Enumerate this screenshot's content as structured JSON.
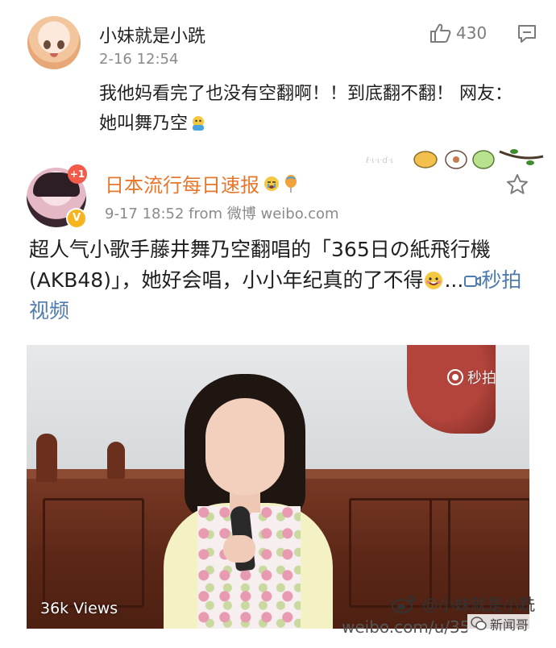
{
  "comment": {
    "username": "小妹就是小跣",
    "time": "2-16 12:54",
    "like_count": "430",
    "text": "我他妈看完了也没有空翻啊！！到底翻不翻！ 网友：她叫舞乃空",
    "icons": [
      "thumbs-up-icon",
      "reply-icon",
      "emoji-icon"
    ]
  },
  "post": {
    "account_name": "日本流行每日速报",
    "avatar_badge": "+1",
    "meta": "9-17 18:52  from 微博 weibo.com",
    "text_main": "超人气小歌手藤井舞乃空翻唱的「365日の紙飛行機 (AKB48)」，她好会唱，小小年纪真的了不得",
    "ellipsis": "...",
    "video_link": "秒拍视频",
    "icons": [
      "star-icon",
      "vip-badge-icon",
      "crying-emoji-icon",
      "balloon-icon",
      "video-link-icon"
    ]
  },
  "video": {
    "views": "36k Views",
    "brand": "秒拍"
  },
  "watermark": {
    "handle": "@小妹就是小跣",
    "url": "weibo.com/u/35",
    "site": "新闻哥"
  },
  "colors": {
    "name_orange": "#e8772e",
    "link_blue": "#4f7bb0",
    "meta_gray": "#8a8a8a"
  }
}
